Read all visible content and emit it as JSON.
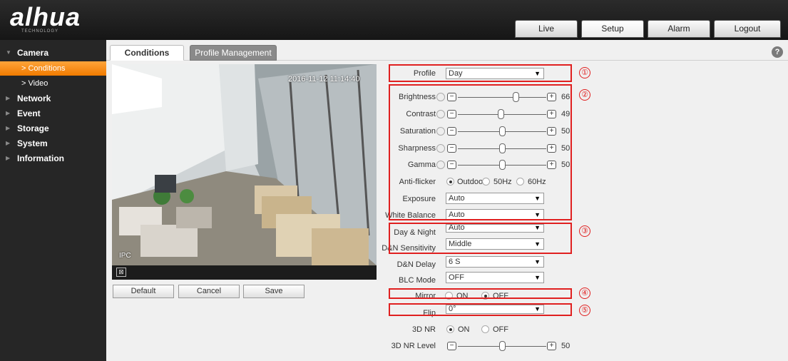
{
  "header": {
    "logo": "alhua",
    "logo_sub": "TECHNOLOGY",
    "tabs": [
      {
        "label": "Live"
      },
      {
        "label": "Setup"
      },
      {
        "label": "Alarm"
      },
      {
        "label": "Logout"
      }
    ],
    "active_tab": "Setup"
  },
  "sidebar": {
    "items": [
      {
        "label": "Camera"
      },
      {
        "label": "> Conditions"
      },
      {
        "label": "> Video"
      },
      {
        "label": "Network"
      },
      {
        "label": "Event"
      },
      {
        "label": "Storage"
      },
      {
        "label": "System"
      },
      {
        "label": "Information"
      }
    ],
    "active_item": "Conditions"
  },
  "content_tabs": [
    {
      "label": "Conditions"
    },
    {
      "label": "Profile Management"
    }
  ],
  "help_icon": "?",
  "video": {
    "timestamp": "2016-11-12 11:14:40",
    "camera_name": "IPC",
    "fullscreen_icon": "⊠"
  },
  "buttons": {
    "default": "Default",
    "cancel": "Cancel",
    "save": "Save"
  },
  "form": {
    "profile": {
      "label": "Profile",
      "value": "Day"
    },
    "brightness": {
      "label": "Brightness",
      "value": 66
    },
    "contrast": {
      "label": "Contrast",
      "value": 49
    },
    "saturation": {
      "label": "Saturation",
      "value": 50
    },
    "sharpness": {
      "label": "Sharpness",
      "value": 50
    },
    "gamma": {
      "label": "Gamma",
      "value": 50
    },
    "anti_flicker": {
      "label": "Anti-flicker",
      "options": [
        "Outdoor",
        "50Hz",
        "60Hz"
      ],
      "selected": "Outdoor"
    },
    "exposure": {
      "label": "Exposure",
      "value": "Auto"
    },
    "white_balance": {
      "label": "White Balance",
      "value": "Auto"
    },
    "day_night": {
      "label": "Day & Night",
      "value": "Auto"
    },
    "dn_sensitivity": {
      "label": "D&N Sensitivity",
      "value": "Middle"
    },
    "dn_delay": {
      "label": "D&N Delay",
      "value": "6 S"
    },
    "blc_mode": {
      "label": "BLC Mode",
      "value": "OFF"
    },
    "mirror": {
      "label": "Mirror",
      "options": [
        "ON",
        "OFF"
      ],
      "selected": "OFF"
    },
    "flip": {
      "label": "Flip",
      "value": "0°"
    },
    "nr3d": {
      "label": "3D NR",
      "options": [
        "ON",
        "OFF"
      ],
      "selected": "ON"
    },
    "nr3d_level": {
      "label": "3D NR Level",
      "value": 50
    }
  },
  "annotations": [
    "①",
    "②",
    "③",
    "④",
    "⑤"
  ],
  "colors": {
    "highlight": "#e02020",
    "active_menu": "#f07b00",
    "sidebar_bg": "#262626"
  }
}
